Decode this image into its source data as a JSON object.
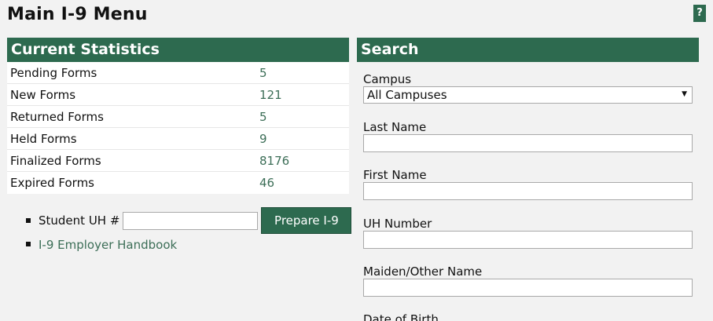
{
  "page_title": "Main I-9 Menu",
  "help_label": "?",
  "stats": {
    "header": "Current Statistics",
    "rows": [
      {
        "label": "Pending Forms",
        "value": "5"
      },
      {
        "label": "New Forms",
        "value": "121"
      },
      {
        "label": "Returned Forms",
        "value": "5"
      },
      {
        "label": "Held Forms",
        "value": "9"
      },
      {
        "label": "Finalized Forms",
        "value": "8176"
      },
      {
        "label": "Expired Forms",
        "value": "46"
      }
    ]
  },
  "quick": {
    "student_label": "Student UH #",
    "student_value": "",
    "prepare_button": "Prepare I-9",
    "handbook_link": "I-9 Employer Handbook"
  },
  "search": {
    "header": "Search",
    "campus_label": "Campus",
    "campus_selected": "All Campuses",
    "last_name_label": "Last Name",
    "first_name_label": "First Name",
    "uh_number_label": "UH Number",
    "maiden_label": "Maiden/Other Name",
    "dob_label": "Date of Birth"
  },
  "colors": {
    "accent": "#2d6a4f",
    "link": "#3c6e57",
    "background": "#f2f2f2"
  }
}
